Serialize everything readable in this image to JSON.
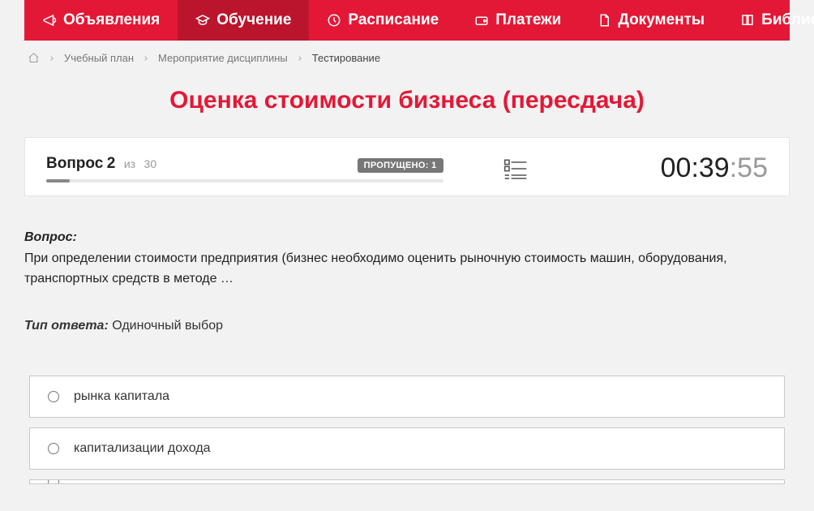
{
  "nav": {
    "items": [
      {
        "label": "Объявления",
        "icon": "megaphone",
        "active": false
      },
      {
        "label": "Обучение",
        "icon": "graduation",
        "active": true
      },
      {
        "label": "Расписание",
        "icon": "clock",
        "active": false
      },
      {
        "label": "Платежи",
        "icon": "wallet",
        "active": false
      },
      {
        "label": "Документы",
        "icon": "doc",
        "active": false
      },
      {
        "label": "Библиотека",
        "icon": "book",
        "active": false,
        "dropdown": true
      }
    ]
  },
  "breadcrumb": {
    "items": [
      "Учебный план",
      "Мероприятие дисциплины"
    ],
    "current": "Тестирование"
  },
  "page_title": "Оценка стоимости бизнеса (пересдача)",
  "quiz": {
    "question_word": "Вопрос",
    "question_num": "2",
    "of_word": "из",
    "total": "30",
    "skipped_label": "ПРОПУЩЕНО: 1",
    "timer": {
      "m": "00",
      "sep1": ":",
      "s": "39",
      "sep2": ":",
      "ms": "55"
    }
  },
  "question": {
    "label": "Вопрос:",
    "text": "При определении стоимости предприятия (бизнес необходимо оценить рыночную стоимость машин, оборудования, транспортных средств в методе …"
  },
  "answer_type": {
    "label": "Тип ответа:",
    "value": "Одиночный выбор"
  },
  "answers": [
    {
      "label": "рынка капитала"
    },
    {
      "label": "капитализации дохода"
    }
  ]
}
